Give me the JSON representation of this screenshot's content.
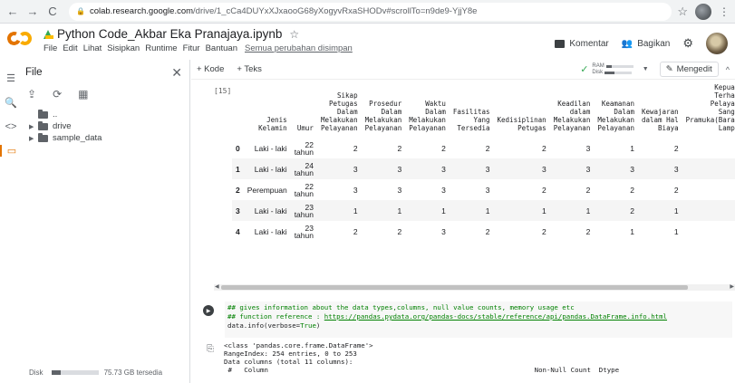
{
  "browser": {
    "url_host": "colab.research.google.com",
    "url_path": "/drive/1_cCa4DUYxXJxaooG68yXogyvRxaSHODv#scrollTo=n9de9-YjjY8e"
  },
  "header": {
    "title": "Python Code_Akbar Eka Pranajaya.ipynb",
    "menu": [
      "File",
      "Edit",
      "Lihat",
      "Sisipkan",
      "Runtime",
      "Fitur",
      "Bantuan"
    ],
    "saved_text": "Semua perubahan disimpan",
    "comment_label": "Komentar",
    "share_label": "Bagikan"
  },
  "file_panel": {
    "title": "File",
    "tree": [
      {
        "label": "..",
        "caret": ""
      },
      {
        "label": "drive",
        "caret": "▶"
      },
      {
        "label": "sample_data",
        "caret": "▶"
      }
    ],
    "disk_label": "Disk",
    "disk_free": "75.73 GB tersedia"
  },
  "toolbar": {
    "add_code": "+ Kode",
    "add_text": "+ Teks",
    "ram_label": "RAM",
    "disk_label": "Disk",
    "edit_label": "Mengedit"
  },
  "table": {
    "cell_label": "[15]",
    "columns": [
      "",
      "Jenis Kelamin",
      "Umur",
      "Sikap Petugas Dalam Melakukan Pelayanan",
      "Prosedur Dalam Melakukan Pelayanan",
      "Waktu Dalam Melakukan Pelayanan",
      "Fasilitas Yang Tersedia",
      "Kedisiplinan Petugas",
      "Keadilan dalam Melakukan Pelayanan",
      "Keamanan Dalam Melakukan Pelayanan",
      "Kewajaran dalam Hal Biaya",
      "Kepuasan Terhadap Pelayanan Sanggar Pramuka(Barang) Lampung"
    ],
    "rows": [
      [
        "0",
        "Laki - laki",
        "22 tahun",
        "2",
        "2",
        "2",
        "2",
        "2",
        "3",
        "1",
        "2",
        ""
      ],
      [
        "1",
        "Laki - laki",
        "24 tahun",
        "3",
        "3",
        "3",
        "3",
        "3",
        "3",
        "3",
        "3",
        ""
      ],
      [
        "2",
        "Perempuan",
        "22 tahun",
        "3",
        "3",
        "3",
        "3",
        "2",
        "2",
        "2",
        "2",
        ""
      ],
      [
        "3",
        "Laki - laki",
        "23 tahun",
        "1",
        "1",
        "1",
        "1",
        "1",
        "1",
        "2",
        "1",
        ""
      ],
      [
        "4",
        "Laki - laki",
        "23 tahun",
        "2",
        "2",
        "3",
        "2",
        "2",
        "2",
        "1",
        "1",
        ""
      ]
    ]
  },
  "code_cell": {
    "line1": "## gives information about the data types,columns, null value counts, memory usage etc",
    "line2_prefix": "## function reference : ",
    "line2_link": "https://pandas.pydata.org/pandas-docs/stable/reference/api/pandas.DataFrame.info.html",
    "line3_plain": "data.info(verbose=",
    "line3_kw": "True",
    "line3_end": ")"
  },
  "output": {
    "text": "<class 'pandas.core.frame.DataFrame'>\nRangeIndex: 254 entries, 0 to 253\nData columns (total 11 columns):\n #   Column                                                                  Non-Null Count  Dtype"
  }
}
